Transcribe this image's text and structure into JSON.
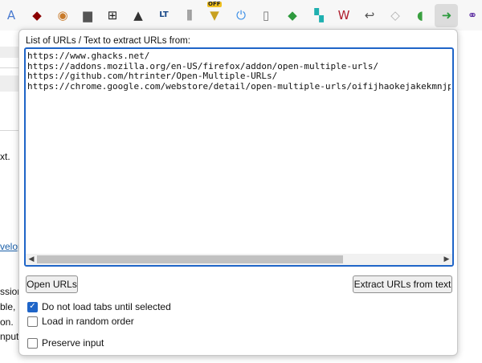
{
  "toolbar": {
    "icons": [
      {
        "name": "translate-icon",
        "glyph": "A",
        "color": "#4a7bd0"
      },
      {
        "name": "ublock-icon",
        "glyph": "◆",
        "color": "#8b0000"
      },
      {
        "name": "monkey-icon",
        "glyph": "◉",
        "color": "#c87a2a"
      },
      {
        "name": "trash-icon",
        "glyph": "▆",
        "color": "#555555"
      },
      {
        "name": "grid-icon",
        "glyph": "⊞",
        "color": "#222222"
      },
      {
        "name": "lock-icon",
        "glyph": "▲",
        "color": "#333333"
      },
      {
        "name": "lt-icon",
        "glyph": "LT",
        "color": "#1a4a8a"
      },
      {
        "name": "equalizer-icon",
        "glyph": "⫼",
        "color": "#444444"
      },
      {
        "name": "off-badge-icon",
        "glyph": "▼",
        "color": "#c8a020",
        "badge": "OFF"
      },
      {
        "name": "power-icon",
        "glyph": "⏻",
        "color": "#3a8ee6"
      },
      {
        "name": "mouse-icon",
        "glyph": "▯",
        "color": "#777777"
      },
      {
        "name": "green-cube-icon",
        "glyph": "◆",
        "color": "#2e9a3e"
      },
      {
        "name": "teal-puzzle-icon",
        "glyph": "▚",
        "color": "#1fb0b0"
      },
      {
        "name": "w-badge-icon",
        "glyph": "W",
        "color": "#b02030"
      },
      {
        "name": "undo-arrow-icon",
        "glyph": "↩",
        "color": "#555555"
      },
      {
        "name": "stack-icon",
        "glyph": "◇",
        "color": "#b0b0b0"
      },
      {
        "name": "leaf-icon",
        "glyph": "◖",
        "color": "#3aa040"
      },
      {
        "name": "open-multiple-urls-icon",
        "glyph": "➜",
        "color": "#2d9a3e"
      },
      {
        "name": "chain-link-icon",
        "glyph": "⚭",
        "color": "#5a2aa0"
      }
    ]
  },
  "background": {
    "snippets": [
      "xt.",
      "velop",
      "ssion",
      "ble, a",
      "on.",
      "nput"
    ]
  },
  "popup": {
    "label": "List of URLs / Text to extract URLs from:",
    "urls_text": "https://www.ghacks.net/\nhttps://addons.mozilla.org/en-US/firefox/addon/open-multiple-urls/\nhttps://github.com/htrinter/Open-Multiple-URLs/\nhttps://chrome.google.com/webstore/detail/open-multiple-urls/oifijhaokejakekmnjp",
    "open_button": "Open URLs",
    "extract_button": "Extract URLs from text",
    "options": [
      {
        "label": "Do not load tabs until selected",
        "checked": true
      },
      {
        "label": "Load in random order",
        "checked": false
      },
      {
        "label": "Preserve input",
        "checked": false
      }
    ],
    "accent": "#1f65c8"
  }
}
